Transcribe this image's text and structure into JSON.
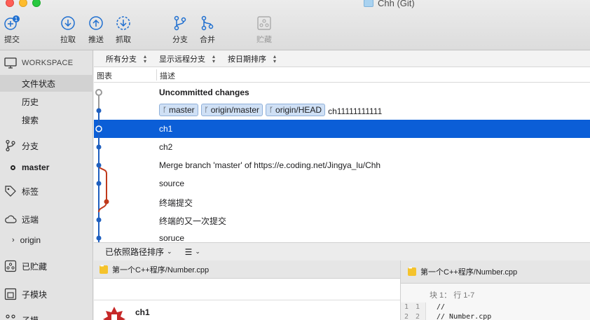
{
  "window": {
    "title": "Chh (Git)"
  },
  "toolbar": {
    "commit": {
      "label": "提交",
      "badge": "1"
    },
    "pull": "拉取",
    "push": "推送",
    "fetch": "抓取",
    "branch": "分支",
    "merge": "合并",
    "stash": "贮藏"
  },
  "sidebar": {
    "workspace": "WORKSPACE",
    "file_status": "文件状态",
    "history": "历史",
    "search": "搜索",
    "branches": "分支",
    "current_branch": "master",
    "tags": "标签",
    "remotes": "远端",
    "remote_origin": "origin",
    "stashes": "已贮藏",
    "submodules": "子模块",
    "partial": "子模"
  },
  "filters": {
    "all_branches": "所有分支",
    "show_remote": "显示远程分支",
    "sort_date": "按日期排序"
  },
  "columns": {
    "graph": "图表",
    "description": "描述"
  },
  "commits": [
    {
      "message": "Uncommitted changes",
      "bold": true
    },
    {
      "message": "ch11111111111",
      "refs": [
        "master",
        "origin/master",
        "origin/HEAD"
      ]
    },
    {
      "message": "ch1",
      "selected": true
    },
    {
      "message": "ch2"
    },
    {
      "message": "Merge branch 'master' of https://e.coding.net/Jingya_lu/Chh"
    },
    {
      "message": "source"
    },
    {
      "message": "终端提交"
    },
    {
      "message": "终端的又一次提交"
    },
    {
      "message": "soruce"
    }
  ],
  "bottom_bar": {
    "sort_by_path": "已依照路径排序",
    "view_icon": "list-icon"
  },
  "files": {
    "path": "第一个C++程序/Number.cpp",
    "commit_author": "ch1"
  },
  "diff": {
    "path": "第一个C++程序/Number.cpp",
    "hunk": "块 1：  行 1-7",
    "lines": [
      {
        "old": "1",
        "new": "1",
        "code": "//"
      },
      {
        "old": "2",
        "new": "2",
        "code": "//  Number.cpp"
      }
    ]
  },
  "colors": {
    "selection": "#0b5ed7",
    "graph_blue": "#1f5fbf",
    "graph_red": "#c0391b"
  }
}
